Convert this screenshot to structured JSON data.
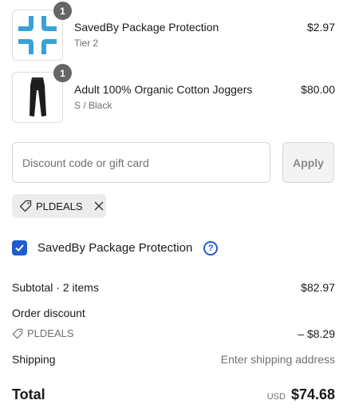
{
  "line_items": [
    {
      "name": "SavedBy Package Protection",
      "variant": "Tier 2",
      "price": "$2.97",
      "quantity": "1",
      "image_icon": "savedby-logo-icon"
    },
    {
      "name": "Adult 100% Organic Cotton Joggers",
      "variant": "S / Black",
      "price": "$80.00",
      "quantity": "1",
      "image_icon": "joggers-image"
    }
  ],
  "discount": {
    "placeholder": "Discount code or gift card",
    "value": "",
    "apply_label": "Apply",
    "applied_code": "PLDEALS"
  },
  "protection": {
    "label": "SavedBy Package Protection",
    "checked": true,
    "help_glyph": "?"
  },
  "summary": {
    "subtotal_label": "Subtotal · 2 items",
    "subtotal_value": "$82.97",
    "order_discount_label": "Order discount",
    "discount_code": "PLDEALS",
    "discount_value": "– $8.29",
    "shipping_label": "Shipping",
    "shipping_value": "Enter shipping address",
    "total_label": "Total",
    "currency": "USD",
    "total_value": "$74.68"
  },
  "colors": {
    "accent": "#1f5bd1",
    "savedby_blue": "#3aa0d8",
    "badge": "#666666"
  }
}
